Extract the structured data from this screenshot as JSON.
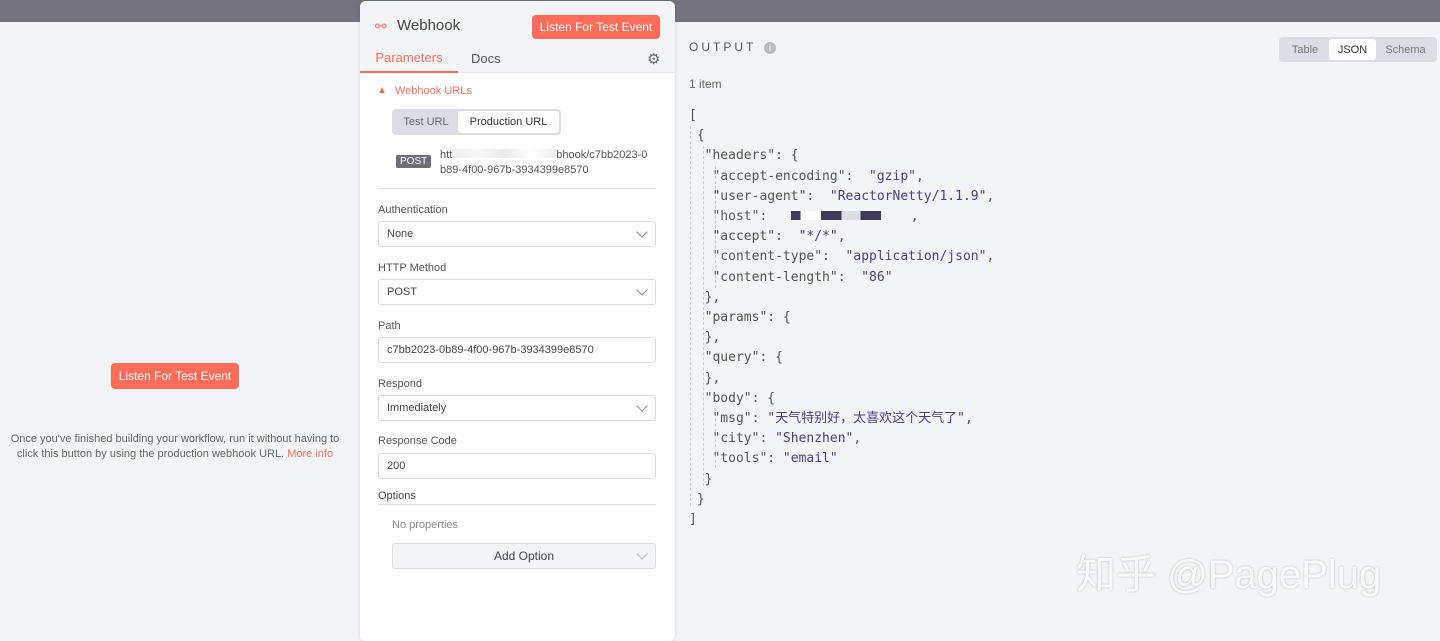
{
  "left": {
    "listen_button": "Listen For Test Event",
    "help_text_1": "Once you've finished building your workflow, run it without having to",
    "help_text_2": "click this button by using the production webhook URL.",
    "more_info": "More info"
  },
  "panel": {
    "title": "Webhook",
    "listen_button": "Listen For Test Event",
    "tabs": [
      "Parameters",
      "Docs"
    ],
    "webhook_urls": "Webhook URLs",
    "url_toggle": [
      "Test URL",
      "Production URL"
    ],
    "method_badge": "POST",
    "url_line1_start": "htt",
    "url_line1_end": "bhook/c7bb2023-0",
    "url_line2": "b89-4f00-967b-3934399e8570",
    "fields": [
      {
        "label": "Authentication",
        "value": "None"
      },
      {
        "label": "HTTP Method",
        "value": "POST"
      },
      {
        "label": "Path",
        "value": "c7bb2023-0b89-4f00-967b-3934399e8570"
      },
      {
        "label": "Respond",
        "value": "Immediately"
      },
      {
        "label": "Response Code",
        "value": "200"
      }
    ],
    "options_label": "Options",
    "no_properties": "No properties",
    "add_option": "Add Option"
  },
  "output": {
    "title": "OUTPUT",
    "count": "1 item",
    "views": [
      "Table",
      "JSON",
      "Schema"
    ],
    "active_view": "JSON",
    "json": {
      "headers": {
        "accept-encoding": "gzip",
        "user-agent": "ReactorNetty/1.1.9",
        "host": "",
        "accept": "*/*",
        "content-type": "application/json",
        "content-length": "86"
      },
      "body": {
        "msg": "天气特别好，太喜欢这个天气了",
        "city": "Shenzhen",
        "tools": "email"
      }
    }
  },
  "watermark": "知乎 @PagePlug",
  "colors": {
    "accent": "#ff6d5a",
    "json_value": "#473f87"
  }
}
